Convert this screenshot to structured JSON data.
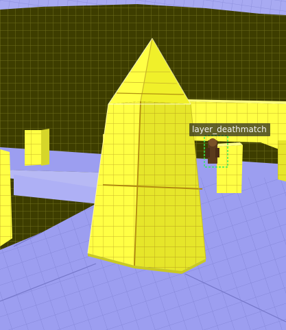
{
  "viewport": {
    "entity_label": "layer_deathmatch"
  },
  "colors": {
    "wall": "#3d3d00",
    "wall_grid": "#6b6b18",
    "floor": "#9c9ef0",
    "floor_grid": "#8486d6",
    "brush": "#ffff44",
    "brush_shade": "#d8d81c",
    "brush_grid": "#b59a10",
    "selection": "#2ee85a"
  },
  "icons": {
    "entity_model": "player-spawn-model"
  }
}
